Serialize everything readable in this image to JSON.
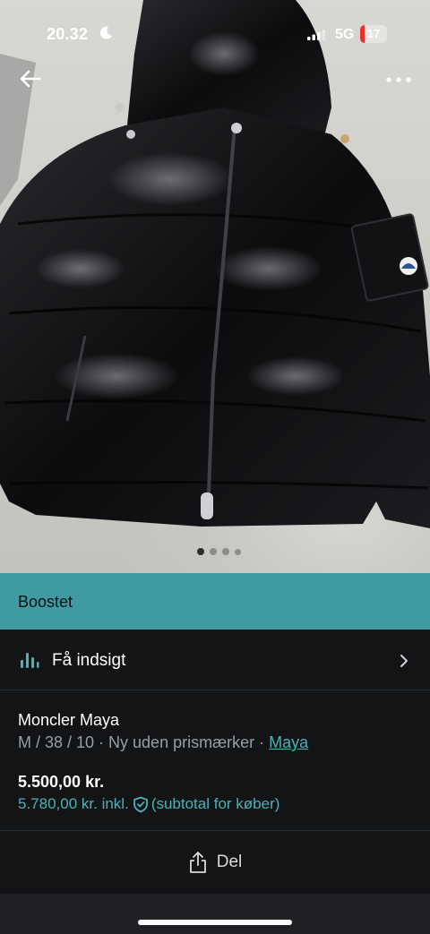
{
  "status_bar": {
    "time": "20.32",
    "network": "5G",
    "battery_level": "17",
    "icons": [
      "moon-icon",
      "signal-icon",
      "battery-icon"
    ]
  },
  "photo": {
    "page_count": 4,
    "active_page": 1,
    "nav_icons": [
      "back-arrow-icon",
      "more-icon"
    ]
  },
  "boost": {
    "label": "Boostet"
  },
  "insight": {
    "label": "Få indsigt",
    "icon": "bar-chart-icon"
  },
  "item": {
    "title": "Moncler Maya",
    "meta": "M / 38 / 10 · Ny uden prismærker · ",
    "brand": "Maya",
    "price": "5.500,00 kr.",
    "price_incl": "5.780,00 kr. inkl.",
    "price_incl_note": "(subtotal for køber)"
  },
  "share": {
    "label": "Del",
    "icon": "share-icon"
  },
  "colors": {
    "accent": "#3f9aa4",
    "link": "#4cb1bb",
    "background": "#131416"
  }
}
